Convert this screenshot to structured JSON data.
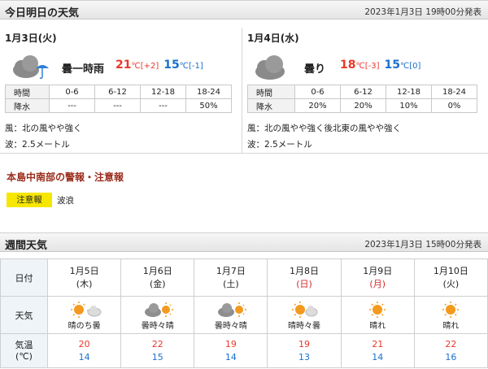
{
  "today_section": {
    "title": "今日明日の天気",
    "issued": "2023年1月3日 19時00分発表"
  },
  "days": [
    {
      "date": "1月3日(火)",
      "weather": "曇一時雨",
      "icon": "cloud-rain-icon",
      "high": "21",
      "high_diff": "[+2]",
      "low": "15",
      "low_diff": "[-1]",
      "unit": "℃",
      "rain_header": [
        "時間",
        "0-6",
        "6-12",
        "12-18",
        "18-24"
      ],
      "rain_values": [
        "降水",
        "---",
        "---",
        "---",
        "50%"
      ],
      "wind": "風：北の風やや強く",
      "wave": "波：2.5メートル"
    },
    {
      "date": "1月4日(水)",
      "weather": "曇り",
      "icon": "cloud-icon",
      "high": "18",
      "high_diff": "[-3]",
      "low": "15",
      "low_diff": "[0]",
      "unit": "℃",
      "rain_header": [
        "時間",
        "0-6",
        "6-12",
        "12-18",
        "18-24"
      ],
      "rain_values": [
        "降水",
        "20%",
        "20%",
        "10%",
        "0%"
      ],
      "wind": "風：北の風やや強く後北東の風やや強く",
      "wave": "波：2.5メートル"
    }
  ],
  "warning": {
    "title": "本島中南部の警報・注意報",
    "badge": "注意報",
    "text": "波浪"
  },
  "week_section": {
    "title": "週間天気",
    "issued": "2023年1月3日 15時00分発表"
  },
  "week": {
    "labels": {
      "date": "日付",
      "weather": "天気",
      "temp": "気温\n(℃)"
    },
    "days": [
      {
        "date": "1月5日",
        "dow": "(木)",
        "sunday": false,
        "icon": "sun-then-cloud-icon",
        "weather": "晴のち曇",
        "high": "20",
        "low": "14"
      },
      {
        "date": "1月6日",
        "dow": "(金)",
        "sunday": false,
        "icon": "cloud-sometimes-sun-icon",
        "weather": "曇時々晴",
        "high": "22",
        "low": "15"
      },
      {
        "date": "1月7日",
        "dow": "(土)",
        "sunday": false,
        "icon": "cloud-sometimes-sun-icon",
        "weather": "曇時々晴",
        "high": "19",
        "low": "14"
      },
      {
        "date": "1月8日",
        "dow": "(日)",
        "sunday": true,
        "icon": "sun-sometimes-cloud-icon",
        "weather": "晴時々曇",
        "high": "19",
        "low": "13"
      },
      {
        "date": "1月9日",
        "dow": "(月)",
        "sunday": true,
        "icon": "sun-icon",
        "weather": "晴れ",
        "high": "21",
        "low": "14"
      },
      {
        "date": "1月10日",
        "dow": "(火)",
        "sunday": false,
        "icon": "sun-icon",
        "weather": "晴れ",
        "high": "22",
        "low": "16"
      }
    ]
  },
  "colors": {
    "high": "#e8382a",
    "low": "#1a6fd0",
    "warning_badge": "#f7e600",
    "warning_title": "#9a2c1c"
  }
}
